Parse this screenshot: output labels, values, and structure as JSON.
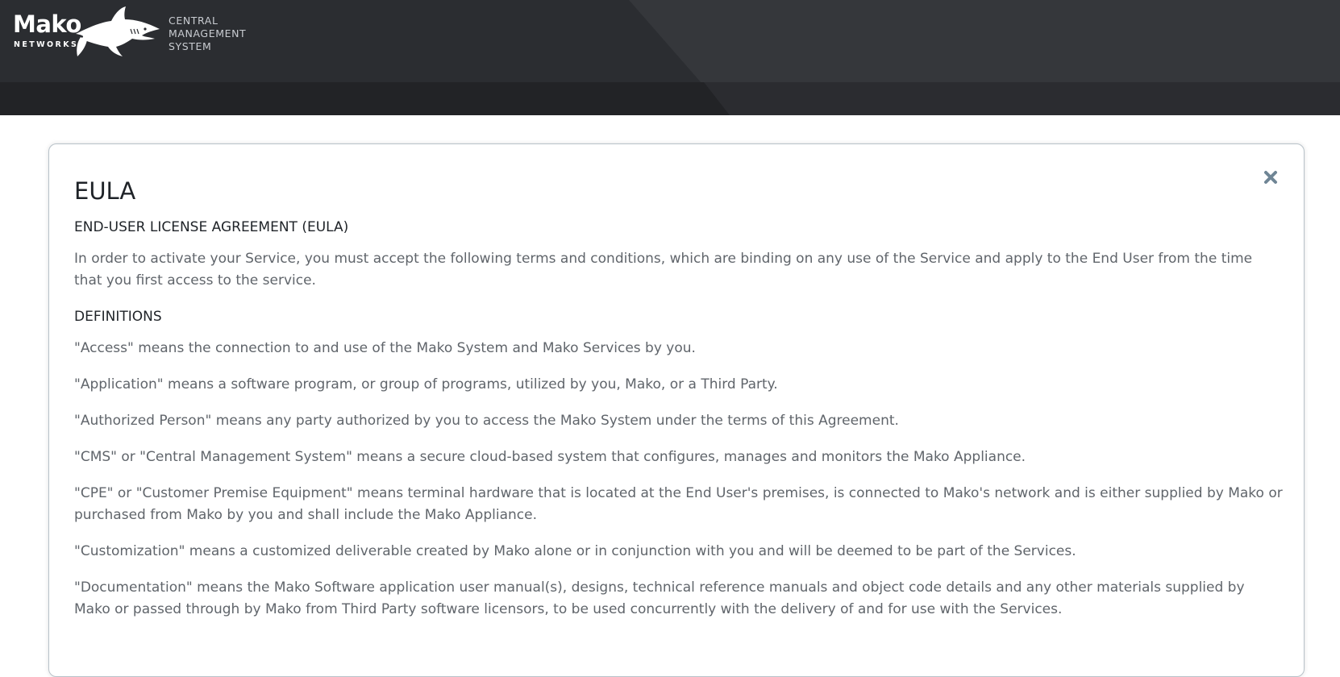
{
  "header": {
    "logo": {
      "wordmark": "Mako",
      "subtext": "NETWORKS",
      "icon": "shark-icon"
    },
    "product_name": [
      "CENTRAL",
      "MANAGEMENT",
      "SYSTEM"
    ]
  },
  "modal": {
    "title": "EULA",
    "close_icon": "close-icon",
    "heading": "END-USER LICENSE AGREEMENT (EULA)",
    "intro": "In order to activate your Service, you must accept the following terms and conditions, which are binding on any use of the Service and apply to the End User from the time that you first access to the service.",
    "definitions_heading": "DEFINITIONS",
    "definitions": [
      "\"Access\" means the connection to and use of the Mako System and Mako Services by you.",
      "\"Application\" means a software program, or group of programs, utilized by you, Mako, or a Third Party.",
      "\"Authorized Person\" means any party authorized by you to access the Mako System under the terms of this Agreement.",
      "\"CMS\" or \"Central Management System\" means a secure cloud-based system that configures, manages and monitors the Mako Appliance.",
      "\"CPE\" or \"Customer Premise Equipment\" means terminal hardware that is located at the End User's premises, is connected to Mako's network and is either supplied by Mako or purchased from Mako by you and shall include the Mako Appliance.",
      "\"Customization\" means a customized deliverable created by Mako alone or in conjunction with you and will be deemed to be part of the Services.",
      "\"Documentation\" means the Mako Software application user manual(s), designs, technical reference manuals and object code details and any other materials supplied by Mako or passed through by Mako from Third Party software licensors, to be used concurrently with the delivery of and for use with the Services."
    ]
  },
  "colors": {
    "header_bg": "#2b2d31",
    "header_band": "#222326",
    "title_text": "#1f2328",
    "body_text": "#60656b",
    "close_icon": "#6f8595"
  }
}
